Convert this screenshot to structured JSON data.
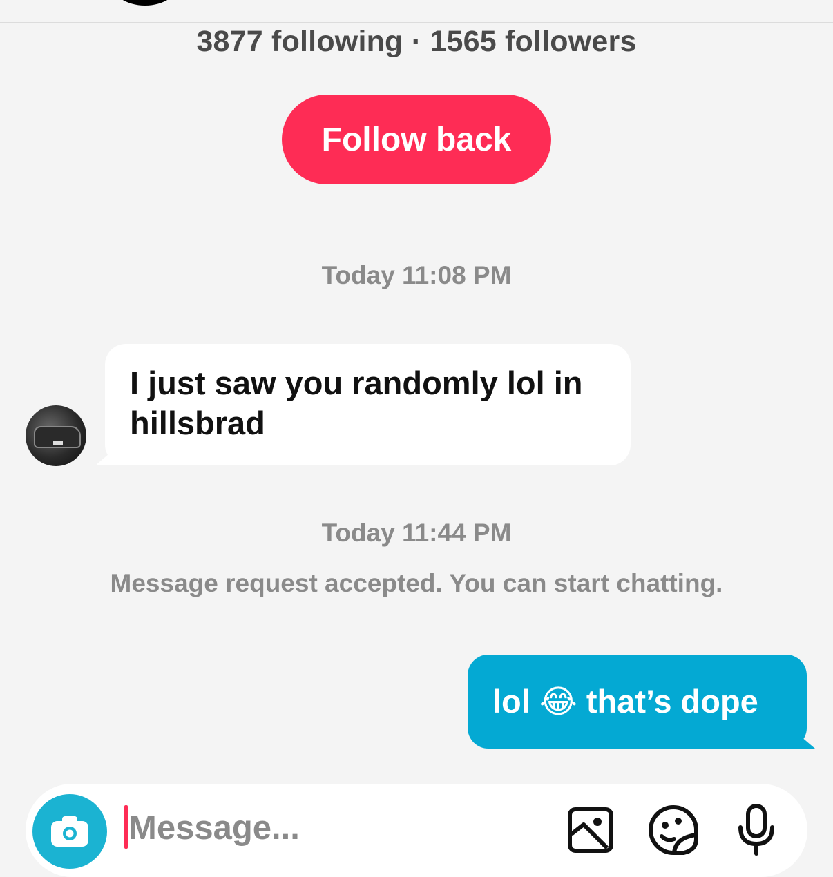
{
  "header": {
    "following_count": "3877",
    "following_label": "following",
    "separator": "·",
    "followers_count": "1565",
    "followers_label": "followers"
  },
  "follow_back_label": "Follow back",
  "messages": {
    "timestamp_1": "Today 11:08 PM",
    "incoming_text": "I just saw you randomly lol in hillsbrad",
    "timestamp_2": "Today 11:44 PM",
    "system_notice": "Message request accepted. You can start chatting.",
    "outgoing_text": "lol 😂 that’s dope"
  },
  "composer": {
    "placeholder": "Message...",
    "icons": [
      "camera-icon",
      "gallery-icon",
      "sticker-icon",
      "microphone-icon"
    ]
  },
  "colors": {
    "accent_red": "#fe2c55",
    "outgoing_bubble": "#04a9d3",
    "camera_button": "#1bb3d2",
    "background": "#f4f4f4"
  }
}
